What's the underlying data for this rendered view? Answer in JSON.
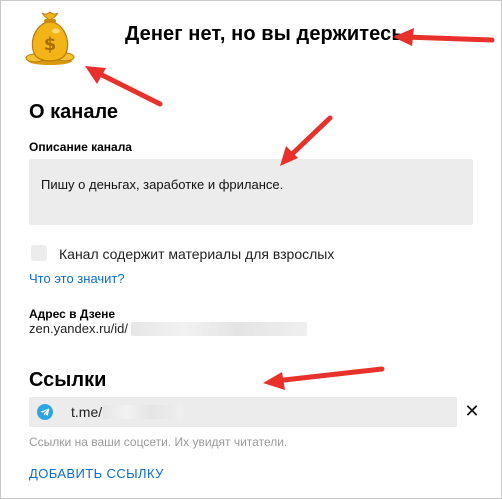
{
  "channel": {
    "avatar_icon": "money-bag-icon",
    "title": "Денег нет, но вы держитесь"
  },
  "about": {
    "section_title": "О канале",
    "description_label": "Описание канала",
    "description_value": "Пишу о деньгах, заработке и фрилансе.",
    "adult_checkbox_label": "Канал содержит материалы для взрослых",
    "adult_checked": false,
    "help_link": "Что это значит?",
    "address_label": "Адрес в Дзене",
    "address_prefix": "zen.yandex.ru/id/"
  },
  "links": {
    "section_title": "Ссылки",
    "items": [
      {
        "icon": "telegram-icon",
        "value": "t.me/"
      }
    ],
    "hint": "Ссылки на ваши соцсети. Их увидят читатели.",
    "add_button": "ДОБАВИТЬ ССЫЛКУ"
  },
  "annotation_color": "#e8312a"
}
